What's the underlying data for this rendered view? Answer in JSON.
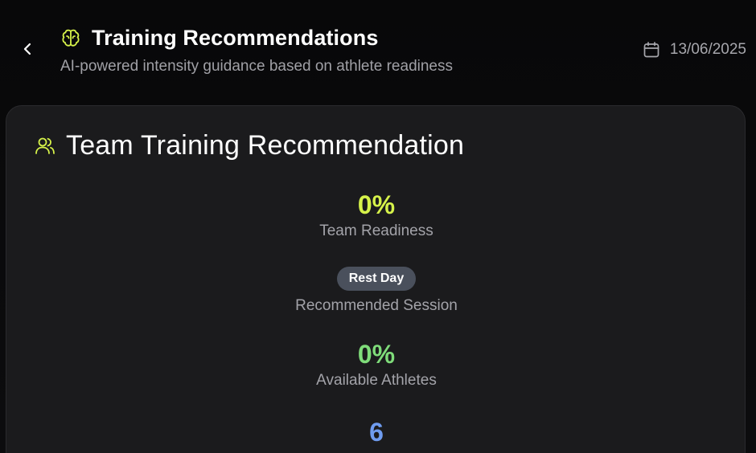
{
  "header": {
    "title": "Training Recommendations",
    "subtitle": "AI-powered intensity guidance based on athlete readiness",
    "date": "13/06/2025",
    "icons": {
      "back": "chevron-left-icon",
      "title": "brain-icon",
      "date": "calendar-icon"
    }
  },
  "card": {
    "title": "Team Training Recommendation",
    "icon": "users-icon",
    "stats": {
      "readiness": {
        "value": "0%",
        "label": "Team Readiness"
      },
      "session": {
        "badge": "Rest Day",
        "label": "Recommended Session"
      },
      "available": {
        "value": "0%",
        "label": "Available Athletes"
      },
      "count": {
        "value": "6"
      }
    }
  },
  "colors": {
    "accent_lime": "#d6f24a",
    "accent_green": "#7fdc7a",
    "accent_blue": "#6f9cf0",
    "badge_bg": "#4a505c",
    "card_bg": "#1b1b1d"
  }
}
